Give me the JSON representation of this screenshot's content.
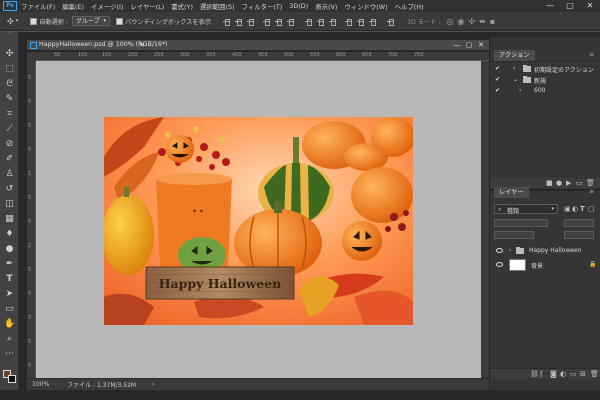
{
  "app": {
    "logo": "Ps"
  },
  "menu": [
    "ファイル(F)",
    "編集(E)",
    "イメージ(I)",
    "レイヤー(L)",
    "書式(Y)",
    "選択範囲(S)",
    "フィルター(T)",
    "3D(D)",
    "表示(V)",
    "ウィンドウ(W)",
    "ヘルプ(H)"
  ],
  "window_controls": {
    "minimize": "—",
    "maximize": "▢",
    "close": "✕"
  },
  "options": {
    "auto_select_label": "自動選択 :",
    "auto_select_target": "グループ",
    "bbox_label": "バウンディングボックスを表示",
    "mode_label": "3D モード :"
  },
  "document": {
    "tab_title": "HappyHalloween.psd @ 100% (RGB/16*)",
    "tab_close": "✕",
    "zoom": "100%",
    "file_info": "ファイル : 1.37M/3.52M",
    "image_sign_text": "Happy Halloween",
    "ruler_top": [
      "50",
      "100",
      "150",
      "200",
      "250",
      "300",
      "350",
      "400",
      "450",
      "500",
      "550",
      "600",
      "650",
      "700",
      "750"
    ],
    "ruler_left": [
      "5",
      "0",
      "5",
      "0",
      "1",
      "5",
      "0",
      "2",
      "5",
      "0",
      "3",
      "5",
      "0"
    ]
  },
  "actions_panel": {
    "tab": "アクション",
    "items": [
      {
        "label": "初期設定のアクション",
        "checked": true
      },
      {
        "label": "新規",
        "checked": true
      },
      {
        "label": "600",
        "checked": true
      }
    ]
  },
  "layers_panel": {
    "tab": "レイヤー",
    "filter_label": "種類",
    "layers": [
      {
        "name": "Happy Halloween",
        "type": "group"
      },
      {
        "name": "背景",
        "type": "background"
      }
    ]
  }
}
